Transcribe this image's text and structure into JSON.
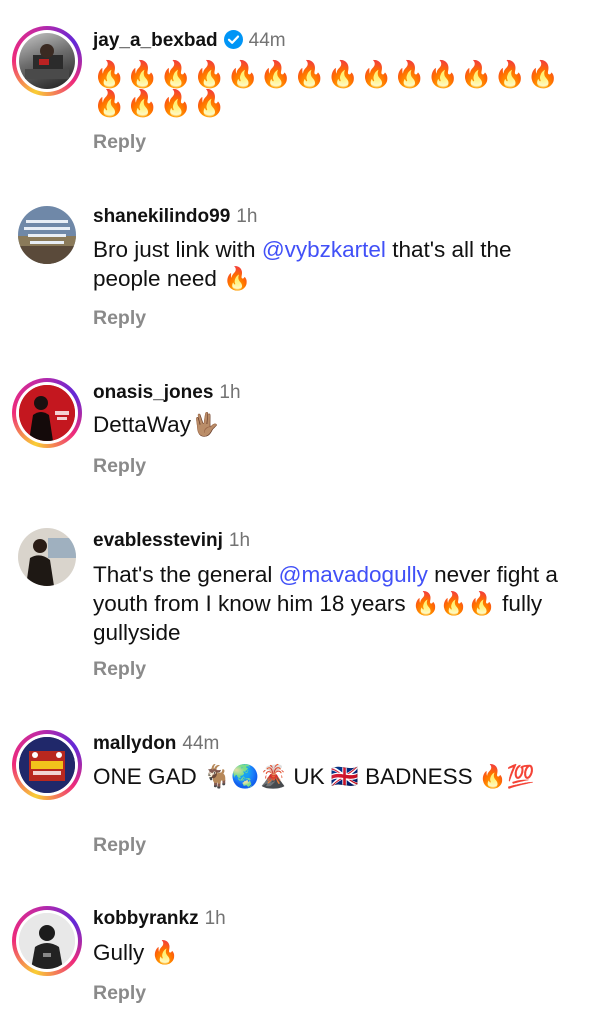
{
  "comments": [
    {
      "username": "jay_a_bexbad",
      "time": "44m",
      "verified": true,
      "text": "🔥🔥🔥🔥🔥🔥🔥🔥🔥🔥🔥🔥🔥🔥🔥🔥🔥🔥",
      "reply": "Reply"
    },
    {
      "username": "shanekilindo99",
      "time": "1h",
      "text_before": "Bro just link with ",
      "mention": "@vybzkartel",
      "text_after": " that's all the people need 🔥",
      "reply": "Reply"
    },
    {
      "username": "onasis_jones",
      "time": "1h",
      "text": "DettaWay🖖🏽",
      "reply": "Reply"
    },
    {
      "username": "evablesstevinj",
      "time": "1h",
      "text_before": "That's the general ",
      "mention": "@mavadogully",
      "text_after": "  never fight a youth from I know  him 18 years 🔥🔥🔥 fully gullyside",
      "reply": "Reply"
    },
    {
      "username": "mallydon",
      "time": "44m",
      "text": "ONE GAD 🐐🌏🌋 UK 🇬🇧 BADNESS 🔥💯",
      "reply": "Reply"
    },
    {
      "username": "kobbyrankz",
      "time": "1h",
      "text": "Gully 🔥",
      "reply": "Reply"
    }
  ]
}
